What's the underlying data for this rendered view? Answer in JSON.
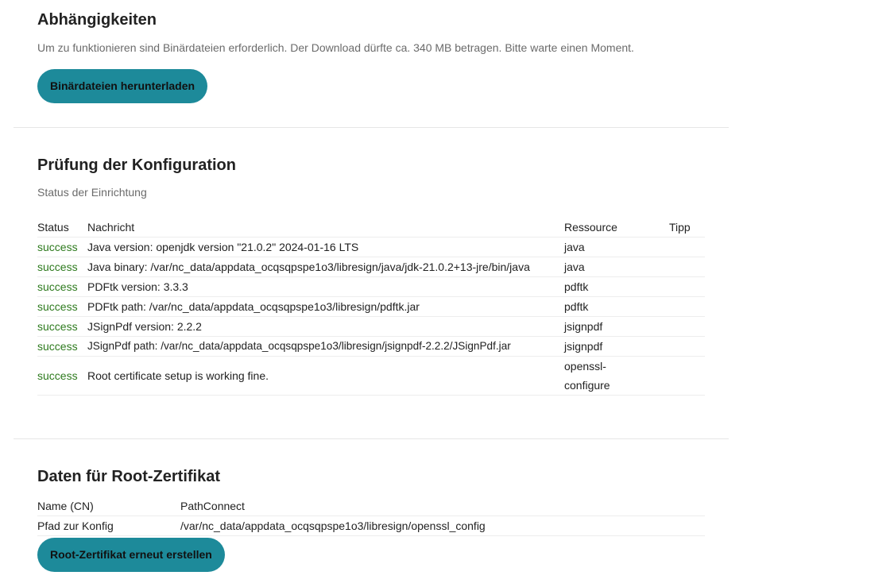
{
  "dependencies": {
    "title": "Abhängigkeiten",
    "description": "Um zu funktionieren sind Binärdateien erforderlich. Der Download dürfte ca. 340 MB betragen. Bitte warte einen Moment.",
    "download_button": "Binärdateien herunterladen"
  },
  "config_check": {
    "title": "Prüfung der Konfiguration",
    "subtitle": "Status der Einrichtung",
    "columns": {
      "status": "Status",
      "message": "Nachricht",
      "resource": "Ressource",
      "tip": "Tipp"
    },
    "rows": [
      {
        "status": "success",
        "message": "Java version: openjdk version \"21.0.2\" 2024-01-16 LTS",
        "resource": "java",
        "tip": ""
      },
      {
        "status": "success",
        "message": "Java binary: /var/nc_data/appdata_ocqsqpspe1o3/libresign/java/jdk-21.0.2+13-jre/bin/java",
        "resource": "java",
        "tip": ""
      },
      {
        "status": "success",
        "message": "PDFtk version: 3.3.3",
        "resource": "pdftk",
        "tip": ""
      },
      {
        "status": "success",
        "message": "PDFtk path: /var/nc_data/appdata_ocqsqpspe1o3/libresign/pdftk.jar",
        "resource": "pdftk",
        "tip": ""
      },
      {
        "status": "success",
        "message": "JSignPdf version: 2.2.2",
        "resource": "jsignpdf",
        "tip": ""
      },
      {
        "status": "success",
        "message": "JSignPdf path: /var/nc_data/appdata_ocqsqpspe1o3/libresign/jsignpdf-2.2.2/JSignPdf.jar",
        "resource": "jsignpdf",
        "tip": ""
      },
      {
        "status": "success",
        "message": "Root certificate setup is working fine.",
        "resource": "openssl-configure",
        "tip": ""
      }
    ]
  },
  "root_cert": {
    "title": "Daten für Root-Zertifikat",
    "rows": [
      {
        "key": "Name (CN)",
        "value": "PathConnect"
      },
      {
        "key": "Pfad zur Konfig",
        "value": "/var/nc_data/appdata_ocqsqpspe1o3/libresign/openssl_config"
      }
    ],
    "regenerate_button": "Root-Zertifikat erneut erstellen"
  },
  "colors": {
    "button_bg": "#1d8a9a",
    "success_text": "#2d7a1d"
  }
}
